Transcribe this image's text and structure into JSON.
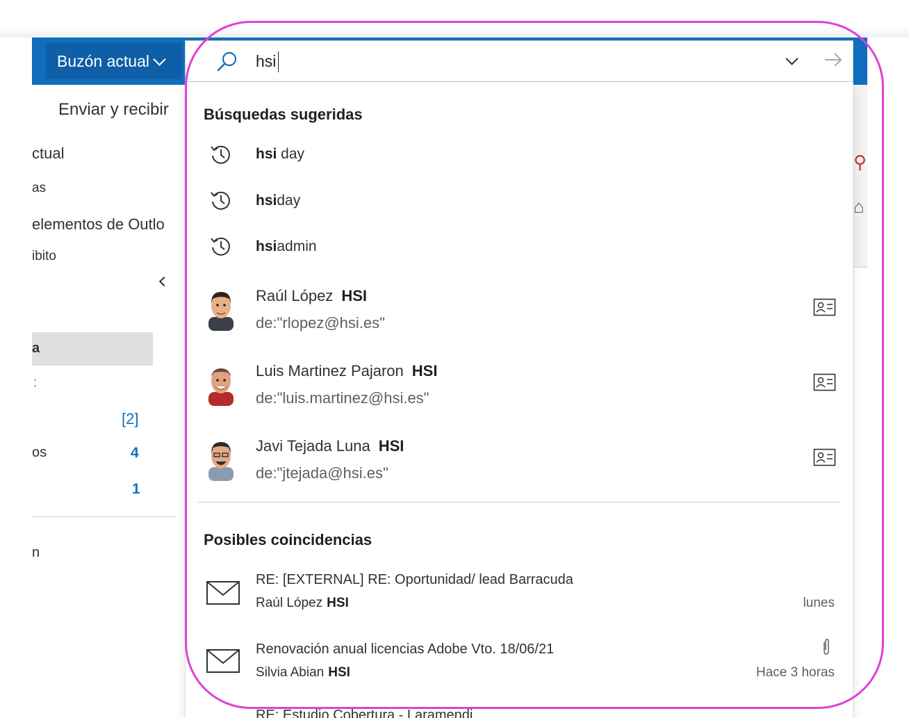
{
  "scope_label": "Buzón actual",
  "search": {
    "value": "hsi"
  },
  "background": {
    "ribbon": {
      "send_receive": "Enviar y recibir",
      "clip_1": "ctual",
      "clip_2": "as",
      "clip_3": "elementos de Outlo",
      "clip_4": "ibito"
    },
    "folders": {
      "clip_1": "a",
      "clip_2": ":",
      "count_1": "[2]",
      "clip_3": "os",
      "count_2": "4",
      "count_3": "1",
      "clip_4": "n"
    }
  },
  "suggested": {
    "title": "Búsquedas sugeridas",
    "history": [
      {
        "bold": "hsi",
        "rest": " day"
      },
      {
        "bold": "hsi",
        "rest": "day"
      },
      {
        "bold": "hsi",
        "rest": "admin"
      }
    ],
    "people": [
      {
        "name": "Raúl López",
        "tag": "HSI",
        "query": "de:\"rlopez@hsi.es\""
      },
      {
        "name": "Luis Martinez Pajaron",
        "tag": "HSI",
        "query": "de:\"luis.martinez@hsi.es\""
      },
      {
        "name": "Javi Tejada Luna",
        "tag": "HSI",
        "query": "de:\"jtejada@hsi.es\""
      }
    ]
  },
  "matches": {
    "title": "Posibles coincidencias",
    "items": [
      {
        "subject": "RE: [EXTERNAL] RE: Oportunidad/ lead  Barracuda",
        "sender": "Raúl López",
        "tag": "HSI",
        "date": "lunes"
      },
      {
        "subject": "Renovación anual licencias Adobe Vto. 18/06/21",
        "sender": "Silvia Abian",
        "tag": "HSI",
        "date": "Hace 3 horas"
      }
    ],
    "peek": "RE: Estudio Cobertura - Laramendi"
  },
  "colors": {
    "brand_blue": "#106ebe",
    "highlight": "#e040d8",
    "unread_count": "#106ebe"
  },
  "icons": [
    "search-icon",
    "chevron-down-icon",
    "arrow-right-icon",
    "history-icon",
    "contact-card-icon",
    "mail-icon",
    "paperclip-icon"
  ]
}
